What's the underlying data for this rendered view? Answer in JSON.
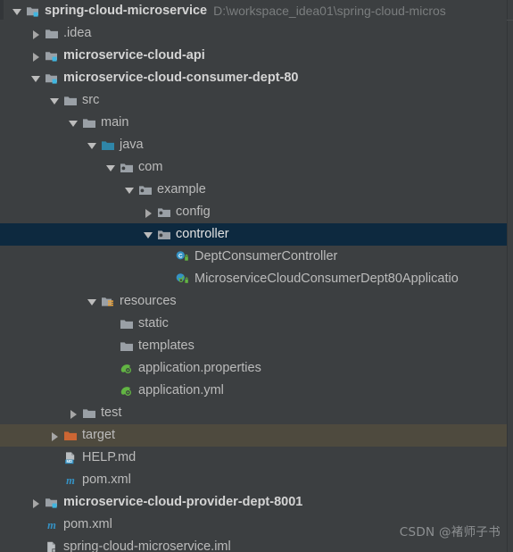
{
  "panel": {
    "name": "Project",
    "background_color": "#3c3f41",
    "selection_color": "#0d293f",
    "excluded_hover_color": "#4e4a3e",
    "text_color": "#bbbbbb",
    "path_text_color": "#7a7d7e"
  },
  "watermark": {
    "text": "CSDN @褚师子书"
  },
  "tree": {
    "rows": [
      {
        "label": "spring-cloud-microservice",
        "path_suffix": "D:\\workspace_idea01\\spring-cloud-micros",
        "icon": "module-folder-icon",
        "arrow": "expanded",
        "depth": 0,
        "bold": true,
        "state": "normal"
      },
      {
        "label": ".idea",
        "path_suffix": "",
        "icon": "folder-icon",
        "arrow": "collapsed",
        "depth": 1,
        "bold": false,
        "state": "normal"
      },
      {
        "label": "microservice-cloud-api",
        "path_suffix": "",
        "icon": "module-folder-icon",
        "arrow": "collapsed",
        "depth": 1,
        "bold": true,
        "state": "normal"
      },
      {
        "label": "microservice-cloud-consumer-dept-80",
        "path_suffix": "",
        "icon": "module-folder-icon",
        "arrow": "expanded",
        "depth": 1,
        "bold": true,
        "state": "normal"
      },
      {
        "label": "src",
        "path_suffix": "",
        "icon": "folder-icon",
        "arrow": "expanded",
        "depth": 2,
        "bold": false,
        "state": "normal"
      },
      {
        "label": "main",
        "path_suffix": "",
        "icon": "folder-icon",
        "arrow": "expanded",
        "depth": 3,
        "bold": false,
        "state": "normal"
      },
      {
        "label": "java",
        "path_suffix": "",
        "icon": "source-root-folder-icon",
        "arrow": "expanded",
        "depth": 4,
        "bold": false,
        "state": "normal"
      },
      {
        "label": "com",
        "path_suffix": "",
        "icon": "package-icon",
        "arrow": "expanded",
        "depth": 5,
        "bold": false,
        "state": "normal"
      },
      {
        "label": "example",
        "path_suffix": "",
        "icon": "package-icon",
        "arrow": "expanded",
        "depth": 6,
        "bold": false,
        "state": "normal"
      },
      {
        "label": "config",
        "path_suffix": "",
        "icon": "package-icon",
        "arrow": "collapsed",
        "depth": 7,
        "bold": false,
        "state": "normal"
      },
      {
        "label": "controller",
        "path_suffix": "",
        "icon": "package-icon",
        "arrow": "expanded",
        "depth": 7,
        "bold": false,
        "state": "selected"
      },
      {
        "label": "DeptConsumerController",
        "path_suffix": "",
        "icon": "java-class-icon",
        "arrow": "none",
        "depth": 8,
        "bold": false,
        "state": "normal"
      },
      {
        "label": "MicroserviceCloudConsumerDept80Applicatio",
        "path_suffix": "",
        "icon": "spring-boot-class-icon",
        "arrow": "none",
        "depth": 8,
        "bold": false,
        "state": "normal"
      },
      {
        "label": "resources",
        "path_suffix": "",
        "icon": "resource-root-folder-icon",
        "arrow": "expanded",
        "depth": 4,
        "bold": false,
        "state": "normal"
      },
      {
        "label": "static",
        "path_suffix": "",
        "icon": "folder-icon",
        "arrow": "none",
        "depth": 5,
        "bold": false,
        "state": "normal"
      },
      {
        "label": "templates",
        "path_suffix": "",
        "icon": "folder-icon",
        "arrow": "none",
        "depth": 5,
        "bold": false,
        "state": "normal"
      },
      {
        "label": "application.properties",
        "path_suffix": "",
        "icon": "spring-config-file-icon",
        "arrow": "none",
        "depth": 5,
        "bold": false,
        "state": "normal"
      },
      {
        "label": "application.yml",
        "path_suffix": "",
        "icon": "spring-config-file-icon",
        "arrow": "none",
        "depth": 5,
        "bold": false,
        "state": "normal"
      },
      {
        "label": "test",
        "path_suffix": "",
        "icon": "folder-icon",
        "arrow": "collapsed",
        "depth": 3,
        "bold": false,
        "state": "normal"
      },
      {
        "label": "target",
        "path_suffix": "",
        "icon": "excluded-folder-icon",
        "arrow": "collapsed",
        "depth": 2,
        "bold": false,
        "state": "hover-excluded"
      },
      {
        "label": "HELP.md",
        "path_suffix": "",
        "icon": "markdown-file-icon",
        "arrow": "none",
        "depth": 2,
        "bold": false,
        "state": "normal"
      },
      {
        "label": "pom.xml",
        "path_suffix": "",
        "icon": "maven-pom-icon",
        "arrow": "none",
        "depth": 2,
        "bold": false,
        "state": "normal"
      },
      {
        "label": "microservice-cloud-provider-dept-8001",
        "path_suffix": "",
        "icon": "module-folder-icon",
        "arrow": "collapsed",
        "depth": 1,
        "bold": true,
        "state": "normal"
      },
      {
        "label": "pom.xml",
        "path_suffix": "",
        "icon": "maven-pom-icon",
        "arrow": "none",
        "depth": 1,
        "bold": false,
        "state": "normal"
      },
      {
        "label": "spring-cloud-microservice.iml",
        "path_suffix": "",
        "icon": "iml-module-file-icon",
        "arrow": "none",
        "depth": 1,
        "bold": false,
        "state": "normal"
      }
    ]
  }
}
